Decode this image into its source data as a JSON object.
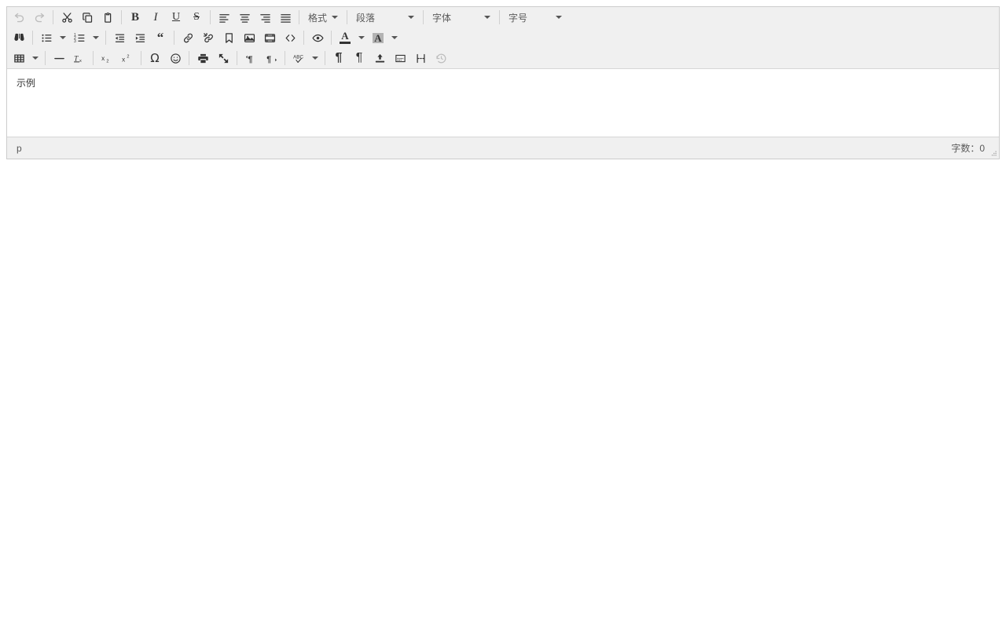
{
  "editor": {
    "toolbar_rows": [
      {
        "groups": [
          {
            "items": [
              {
                "name": "undo-button",
                "icon": "undo-icon",
                "label": "撤销",
                "disabled": true
              },
              {
                "name": "redo-button",
                "icon": "redo-icon",
                "label": "重做",
                "disabled": true
              }
            ]
          },
          {
            "items": [
              {
                "name": "cut-button",
                "icon": "scissors-icon",
                "label": "剪切"
              },
              {
                "name": "copy-button",
                "icon": "copy-icon",
                "label": "复制"
              },
              {
                "name": "paste-button",
                "icon": "paste-icon",
                "label": "粘贴"
              }
            ]
          },
          {
            "items": [
              {
                "name": "bold-button",
                "icon": "bold-icon",
                "label": "粗体"
              },
              {
                "name": "italic-button",
                "icon": "italic-icon",
                "label": "斜体"
              },
              {
                "name": "underline-button",
                "icon": "underline-icon",
                "label": "下划线"
              },
              {
                "name": "strikethrough-button",
                "icon": "strikethrough-icon",
                "label": "删除线"
              }
            ]
          },
          {
            "items": [
              {
                "name": "align-left-button",
                "icon": "align-left-icon",
                "label": "左对齐"
              },
              {
                "name": "align-center-button",
                "icon": "align-center-icon",
                "label": "居中对齐"
              },
              {
                "name": "align-right-button",
                "icon": "align-right-icon",
                "label": "右对齐"
              },
              {
                "name": "align-justify-button",
                "icon": "align-justify-icon",
                "label": "两端对齐"
              }
            ]
          }
        ],
        "format_menu": {
          "label": "格式"
        },
        "selects": [
          {
            "name": "block-format-select",
            "value": "段落"
          },
          {
            "name": "font-family-select",
            "value": "字体"
          },
          {
            "name": "font-size-select",
            "value": "字号"
          }
        ]
      },
      {
        "groups": [
          {
            "items": [
              {
                "name": "search-replace-button",
                "icon": "binoculars-icon",
                "label": "查找和替换"
              }
            ]
          },
          {
            "items": [
              {
                "name": "bullet-list-button",
                "icon": "bullet-list-icon",
                "label": "无序列表",
                "split": true
              },
              {
                "name": "numbered-list-button",
                "icon": "numbered-list-icon",
                "label": "有序列表",
                "split": true
              }
            ]
          },
          {
            "items": [
              {
                "name": "outdent-button",
                "icon": "outdent-icon",
                "label": "减少缩进"
              },
              {
                "name": "indent-button",
                "icon": "indent-icon",
                "label": "增加缩进"
              },
              {
                "name": "blockquote-button",
                "icon": "quote-icon",
                "label": "引用"
              }
            ]
          },
          {
            "items": [
              {
                "name": "insert-link-button",
                "icon": "link-icon",
                "label": "插入链接"
              },
              {
                "name": "unlink-button",
                "icon": "unlink-icon",
                "label": "取消链接"
              },
              {
                "name": "anchor-button",
                "icon": "bookmark-icon",
                "label": "锚点"
              },
              {
                "name": "insert-image-button",
                "icon": "image-icon",
                "label": "插入图片"
              },
              {
                "name": "insert-media-button",
                "icon": "media-icon",
                "label": "插入媒体"
              },
              {
                "name": "source-code-button",
                "icon": "code-icon",
                "label": "源代码"
              }
            ]
          },
          {
            "items": [
              {
                "name": "preview-button",
                "icon": "eye-icon",
                "label": "预览"
              }
            ]
          },
          {
            "items": [
              {
                "name": "text-color-button",
                "icon": "text-color-icon",
                "label": "文字颜色",
                "split": true
              },
              {
                "name": "background-color-button",
                "icon": "background-color-icon",
                "label": "背景颜色",
                "split": true
              }
            ]
          }
        ]
      },
      {
        "groups": [
          {
            "items": [
              {
                "name": "table-button",
                "icon": "table-icon",
                "label": "表格",
                "split": true
              }
            ]
          },
          {
            "items": [
              {
                "name": "horizontal-rule-button",
                "icon": "horizontal-rule-icon",
                "label": "水平线"
              },
              {
                "name": "remove-format-button",
                "icon": "remove-format-icon",
                "label": "清除格式"
              }
            ]
          },
          {
            "items": [
              {
                "name": "subscript-button",
                "icon": "subscript-icon",
                "label": "下标"
              },
              {
                "name": "superscript-button",
                "icon": "superscript-icon",
                "label": "上标"
              }
            ]
          },
          {
            "items": [
              {
                "name": "special-character-button",
                "icon": "omega-icon",
                "label": "特殊字符"
              },
              {
                "name": "emoticons-button",
                "icon": "smiley-icon",
                "label": "表情"
              }
            ]
          },
          {
            "items": [
              {
                "name": "print-button",
                "icon": "printer-icon",
                "label": "打印"
              },
              {
                "name": "fullscreen-button",
                "icon": "fullscreen-icon",
                "label": "全屏"
              }
            ]
          },
          {
            "items": [
              {
                "name": "ltr-button",
                "icon": "ltr-icon",
                "label": "从左到右"
              },
              {
                "name": "rtl-button",
                "icon": "rtl-icon",
                "label": "从右到左"
              }
            ]
          },
          {
            "items": [
              {
                "name": "spellchecker-button",
                "icon": "spellcheck-icon",
                "label": "拼写检查",
                "split": true
              }
            ]
          },
          {
            "items": [
              {
                "name": "visual-blocks-button",
                "icon": "pilcrow-bold-icon",
                "label": "显示区块"
              },
              {
                "name": "show-invisible-characters-button",
                "icon": "pilcrow-icon",
                "label": "显示不可见字符"
              },
              {
                "name": "insert-template-button",
                "icon": "upload-icon",
                "label": "插入模板"
              },
              {
                "name": "visual-characters-button",
                "icon": "visualchars-icon",
                "label": "可见字符"
              },
              {
                "name": "page-break-button",
                "icon": "page-break-icon",
                "label": "分页符"
              },
              {
                "name": "restore-draft-button",
                "icon": "restore-draft-icon",
                "label": "恢复草稿",
                "disabled": true
              }
            ]
          }
        ]
      }
    ],
    "content": {
      "paragraph": "示例"
    },
    "statusbar": {
      "element_path": "p",
      "word_count": "字数：0",
      "resize_handle": "resize-grip"
    },
    "colors": {
      "toolbar_bg": "#f0f0f0",
      "border": "#cccccc",
      "icon": "#333333",
      "disabled_icon": "#bdbdbd",
      "text": "#595959",
      "content_bg": "#ffffff",
      "highlight_swatch": "#b3b3b3"
    }
  }
}
